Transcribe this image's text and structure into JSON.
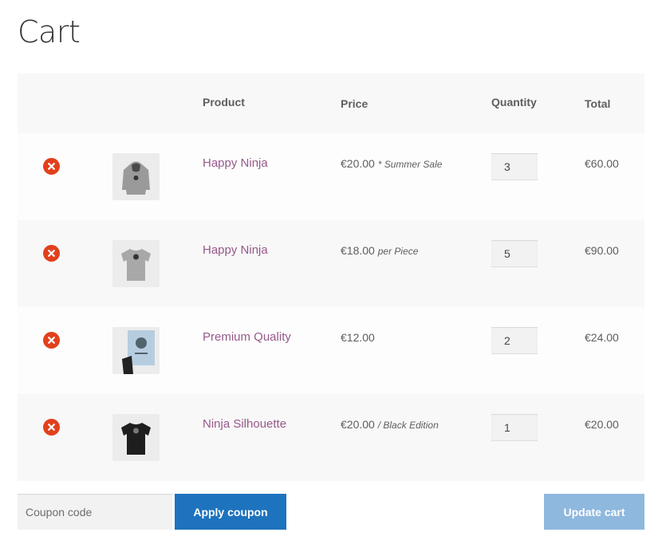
{
  "page": {
    "title": "Cart"
  },
  "table": {
    "headers": {
      "product": "Product",
      "price": "Price",
      "quantity": "Quantity",
      "total": "Total"
    }
  },
  "items": [
    {
      "name": "Happy Ninja",
      "price": "€20.00",
      "note": "* Summer Sale",
      "quantity": "3",
      "total": "€60.00",
      "image": "hoodie-grey"
    },
    {
      "name": "Happy Ninja",
      "price": "€18.00",
      "note": "per Piece",
      "quantity": "5",
      "total": "€90.00",
      "image": "tshirt-grey"
    },
    {
      "name": "Premium Quality",
      "price": "€12.00",
      "note": "",
      "quantity": "2",
      "total": "€24.00",
      "image": "poster-blue"
    },
    {
      "name": "Ninja Silhouette",
      "price": "€20.00",
      "note": "/ Black Edition",
      "quantity": "1",
      "total": "€20.00",
      "image": "tshirt-black"
    }
  ],
  "coupon": {
    "placeholder": "Coupon code",
    "value": ""
  },
  "buttons": {
    "apply_coupon": "Apply coupon",
    "update_cart": "Update cart"
  },
  "colors": {
    "link": "#96588a",
    "remove": "#e2401c",
    "primary_button": "#1e73be",
    "disabled_button": "#8fb8de"
  },
  "icons": {
    "remove": "remove-icon"
  }
}
